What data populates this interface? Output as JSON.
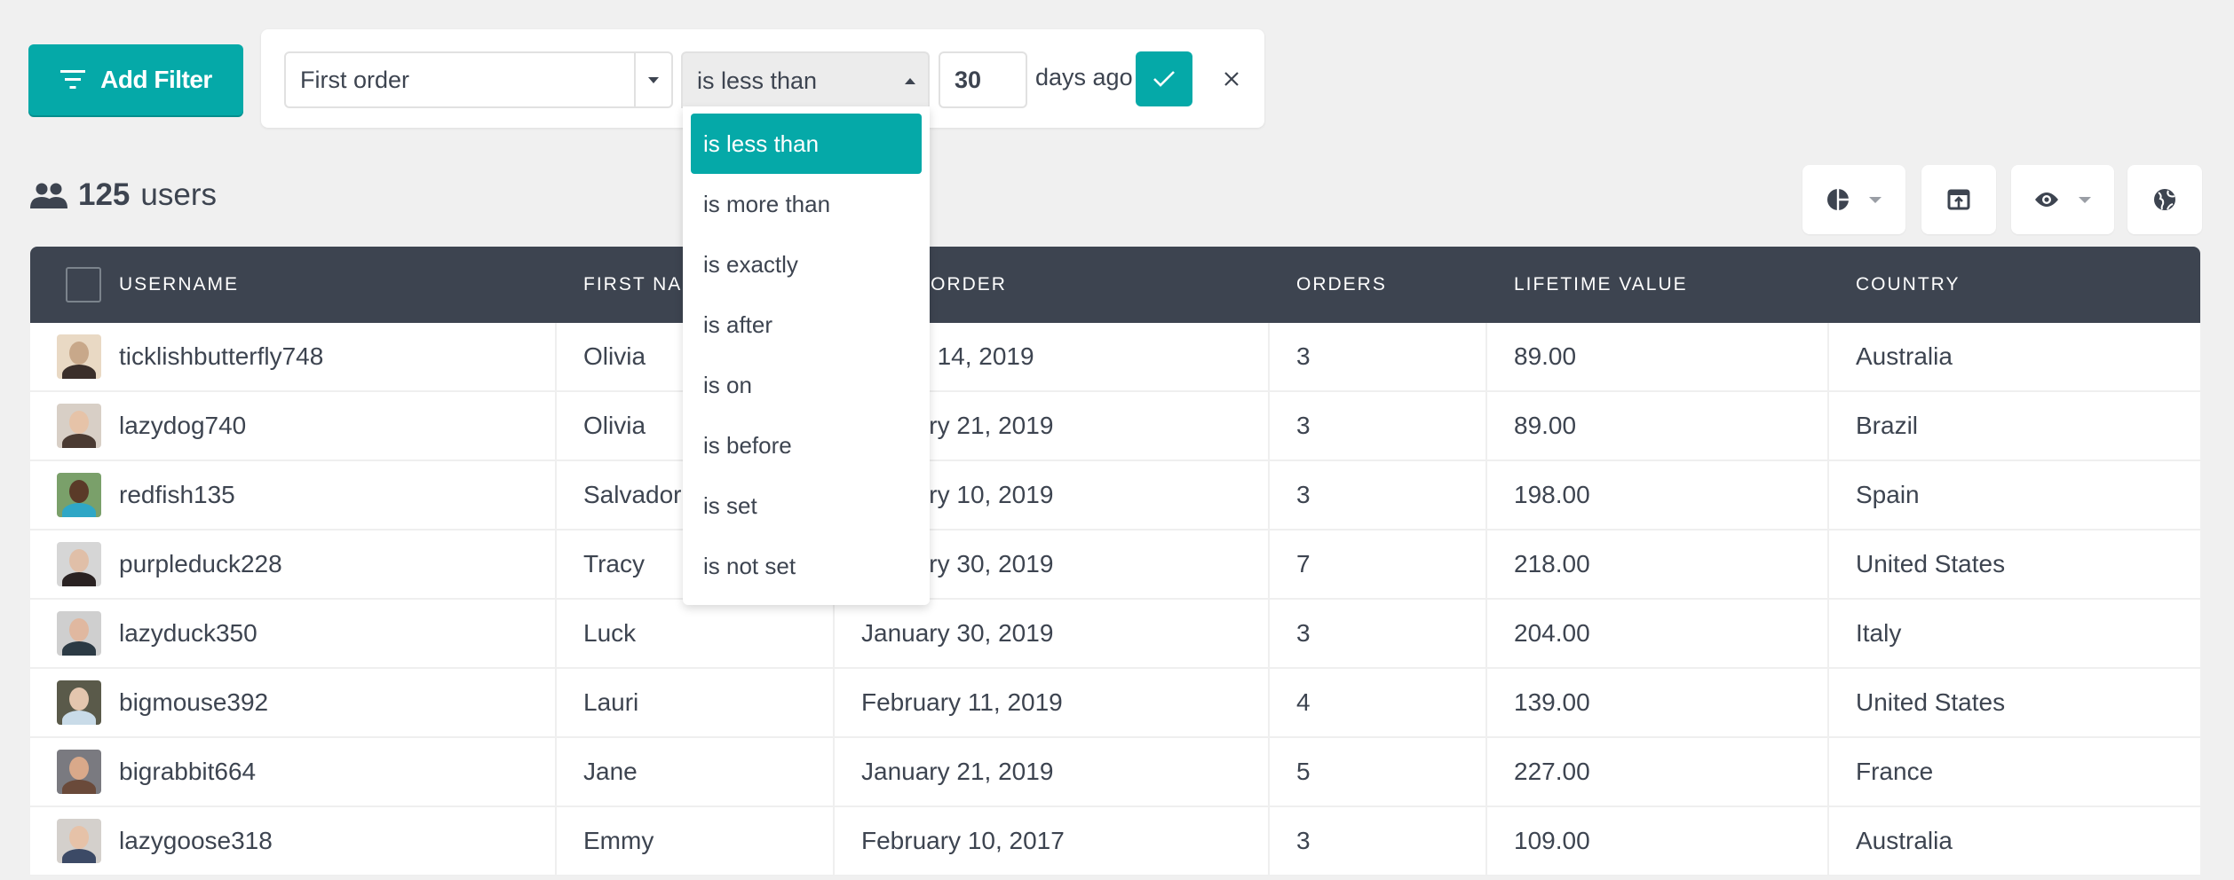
{
  "filter_bar": {
    "add_filter_label": "Add Filter",
    "field_value": "First order",
    "operator_value": "is less than",
    "amount_value": "30",
    "unit_label": "days ago"
  },
  "operator_options": [
    {
      "label": "is less than",
      "selected": true
    },
    {
      "label": "is more than",
      "selected": false
    },
    {
      "label": "is exactly",
      "selected": false
    },
    {
      "label": "is after",
      "selected": false
    },
    {
      "label": "is on",
      "selected": false
    },
    {
      "label": "is before",
      "selected": false
    },
    {
      "label": "is set",
      "selected": false
    },
    {
      "label": "is not set",
      "selected": false
    }
  ],
  "summary": {
    "count": "125",
    "label": "users"
  },
  "toolbar": {
    "icons": [
      "pie-chart-icon",
      "export-icon",
      "eye-icon",
      "globe-icon"
    ]
  },
  "table": {
    "headers": [
      "USERNAME",
      "FIRST NAME",
      "FIRST ORDER",
      "ORDERS",
      "LIFETIME VALUE",
      "COUNTRY"
    ],
    "rows": [
      {
        "username": "ticklishbutterfly748",
        "first_name": "Olivia",
        "first_order": "March 14, 2019",
        "orders": "3",
        "lifetime_value": "89.00",
        "country": "Australia"
      },
      {
        "username": "lazydog740",
        "first_name": "Olivia",
        "first_order": "January 21, 2019",
        "orders": "3",
        "lifetime_value": "89.00",
        "country": "Brazil"
      },
      {
        "username": "redfish135",
        "first_name": "Salvador",
        "first_order": "January 10, 2019",
        "orders": "3",
        "lifetime_value": "198.00",
        "country": "Spain"
      },
      {
        "username": "purpleduck228",
        "first_name": "Tracy",
        "first_order": "January 30, 2019",
        "orders": "7",
        "lifetime_value": "218.00",
        "country": "United States"
      },
      {
        "username": "lazyduck350",
        "first_name": "Luck",
        "first_order": "January 30, 2019",
        "orders": "3",
        "lifetime_value": "204.00",
        "country": "Italy"
      },
      {
        "username": "bigmouse392",
        "first_name": "Lauri",
        "first_order": "February 11, 2019",
        "orders": "4",
        "lifetime_value": "139.00",
        "country": "United States"
      },
      {
        "username": "bigrabbit664",
        "first_name": "Jane",
        "first_order": "January 21, 2019",
        "orders": "5",
        "lifetime_value": "227.00",
        "country": "France"
      },
      {
        "username": "lazygoose318",
        "first_name": "Emmy",
        "first_order": "February 10, 2017",
        "orders": "3",
        "lifetime_value": "109.00",
        "country": "Australia"
      }
    ]
  },
  "colors": {
    "accent": "#05a9a8",
    "header_bg": "#3d4450",
    "text": "#3d4450",
    "page_bg": "#f0f0f0"
  }
}
